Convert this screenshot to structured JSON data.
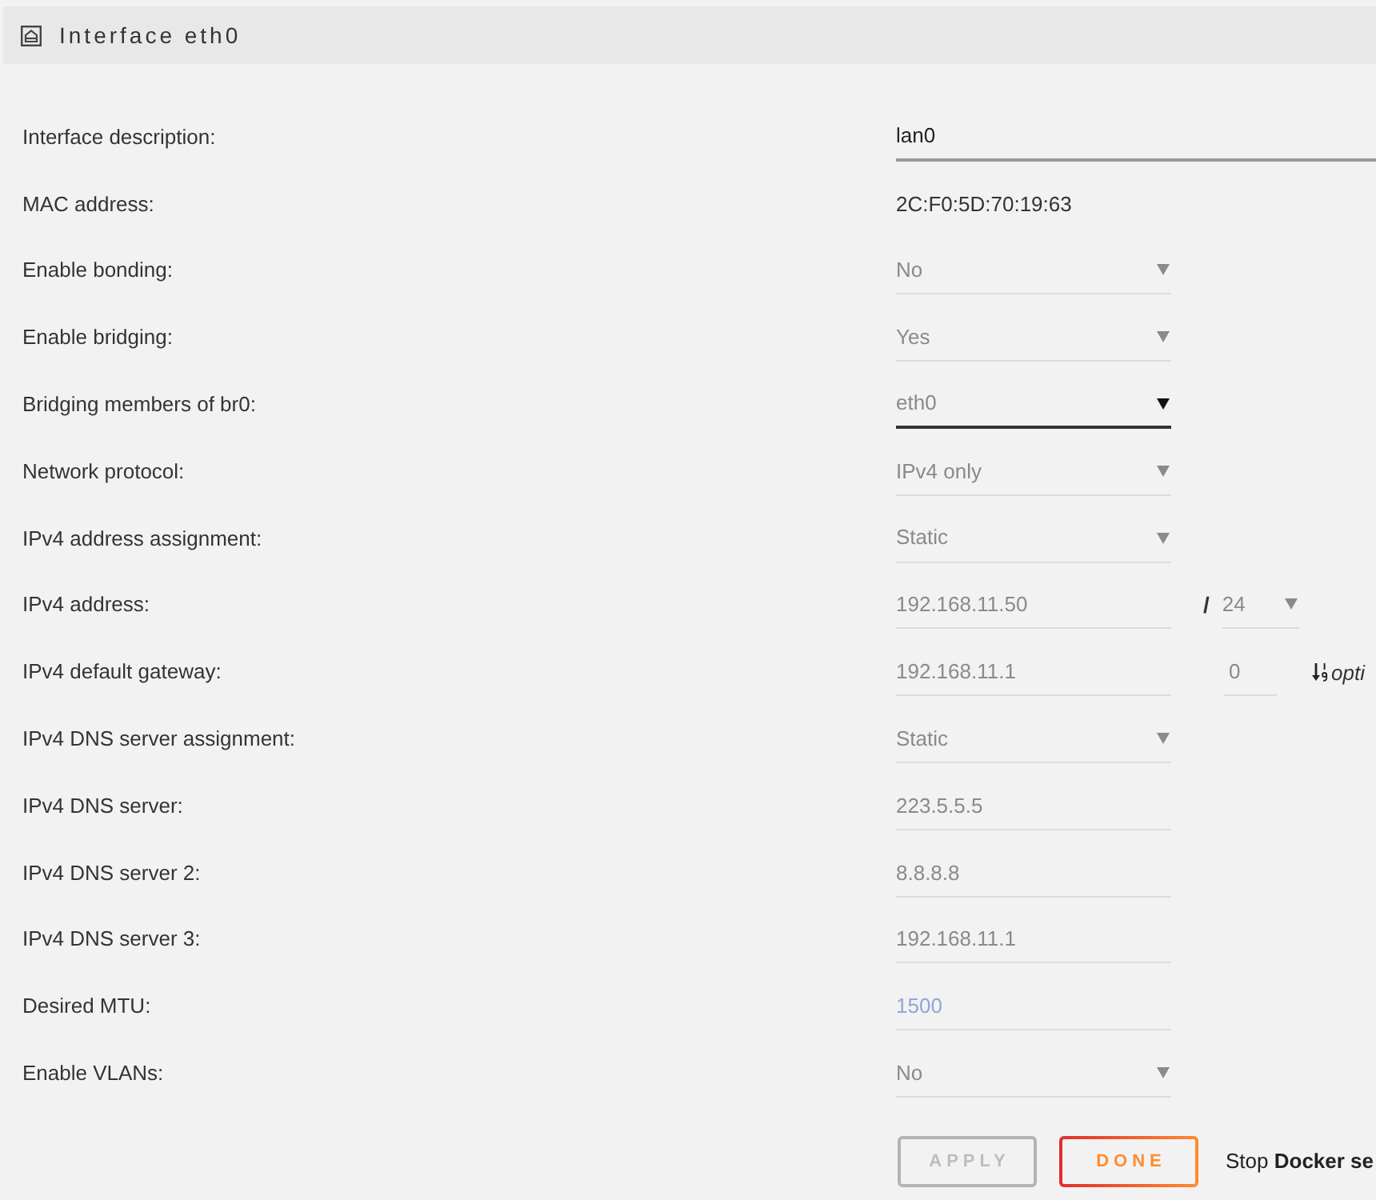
{
  "header": {
    "title": "Interface eth0"
  },
  "rows": [
    {
      "label": "Interface description:",
      "controls": [
        {
          "kind": "wide_input",
          "value": "lan0",
          "disabled": false
        }
      ]
    },
    {
      "label": "MAC address:",
      "controls": [
        {
          "kind": "text",
          "value": "2C:F0:5D:70:19:63"
        }
      ]
    },
    {
      "label": "Enable bonding:",
      "controls": [
        {
          "kind": "select",
          "value": "No",
          "disabled": true
        }
      ]
    },
    {
      "label": "Enable bridging:",
      "controls": [
        {
          "kind": "select",
          "value": "Yes",
          "disabled": true
        }
      ]
    },
    {
      "label": "Bridging members of br0:",
      "controls": [
        {
          "kind": "select",
          "value": "eth0",
          "disabled": false
        }
      ]
    },
    {
      "label": "Network protocol:",
      "controls": [
        {
          "kind": "select",
          "value": "IPv4 only",
          "disabled": true
        }
      ]
    },
    {
      "label": "IPv4 address assignment:",
      "controls": [
        {
          "kind": "select",
          "value": "Static",
          "disabled": true
        }
      ]
    },
    {
      "label": "IPv4 address:",
      "controls": [
        {
          "kind": "input",
          "value": "192.168.11.50",
          "disabled": true
        },
        {
          "kind": "separator",
          "text": "/"
        },
        {
          "kind": "select",
          "value": "24",
          "disabled": true
        }
      ]
    },
    {
      "label": "IPv4 default gateway:",
      "controls": [
        {
          "kind": "input",
          "value": "192.168.11.1",
          "disabled": true
        },
        {
          "kind": "input",
          "value": "0",
          "disabled": true
        },
        {
          "kind": "note",
          "text": "opti"
        }
      ]
    },
    {
      "label": "IPv4 DNS server assignment:",
      "controls": [
        {
          "kind": "select",
          "value": "Static",
          "disabled": true
        }
      ]
    },
    {
      "label": "IPv4 DNS server:",
      "controls": [
        {
          "kind": "input",
          "value": "223.5.5.5",
          "disabled": true
        }
      ]
    },
    {
      "label": "IPv4 DNS server 2:",
      "controls": [
        {
          "kind": "input",
          "value": "8.8.8.8",
          "disabled": true
        }
      ]
    },
    {
      "label": "IPv4 DNS server 3:",
      "controls": [
        {
          "kind": "input",
          "value": "192.168.11.1",
          "disabled": true
        }
      ]
    },
    {
      "label": "Desired MTU:",
      "controls": [
        {
          "kind": "input",
          "placeholder": "1500",
          "disabled": true
        }
      ]
    },
    {
      "label": "Enable VLANs:",
      "controls": [
        {
          "kind": "select",
          "value": "No",
          "disabled": true
        }
      ]
    }
  ],
  "buttons": [
    {
      "label": "APPLY",
      "disabled": true
    },
    {
      "label": "DONE",
      "disabled": false
    }
  ],
  "footer_note": "Stop **Docker se**"
}
